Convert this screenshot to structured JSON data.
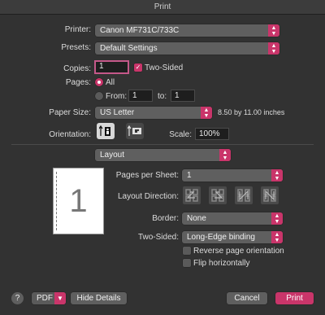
{
  "window": {
    "title": "Print"
  },
  "printer": {
    "label": "Printer:",
    "value": "Canon MF731C/733C"
  },
  "presets": {
    "label": "Presets:",
    "value": "Default Settings"
  },
  "copies": {
    "label": "Copies:",
    "value": "1",
    "two_sided_label": "Two-Sided",
    "two_sided_checked": true
  },
  "pages": {
    "label": "Pages:",
    "all_label": "All",
    "from_label": "From:",
    "from_value": "1",
    "to_label": "to:",
    "to_value": "1"
  },
  "paper": {
    "label": "Paper Size:",
    "value": "US Letter",
    "dimensions": "8.50 by 11.00 inches"
  },
  "orientation": {
    "label": "Orientation:",
    "selected": "portrait"
  },
  "scale": {
    "label": "Scale:",
    "value": "100%"
  },
  "section": {
    "value": "Layout"
  },
  "preview": {
    "page_number": "1"
  },
  "layout": {
    "pages_per_sheet_label": "Pages per Sheet:",
    "pages_per_sheet_value": "1",
    "direction_label": "Layout Direction:",
    "border_label": "Border:",
    "border_value": "None",
    "two_sided_label": "Two-Sided:",
    "two_sided_value": "Long-Edge binding",
    "reverse_label": "Reverse page orientation",
    "flip_label": "Flip horizontally"
  },
  "footer": {
    "help": "?",
    "pdf": "PDF",
    "hide_details": "Hide Details",
    "cancel": "Cancel",
    "print": "Print"
  },
  "colors": {
    "accent": "#c9356a",
    "background": "#323232"
  },
  "icons": [
    "chevron-updown-icon",
    "portrait-icon",
    "landscape-icon",
    "layout-direction-icon",
    "help-icon"
  ]
}
